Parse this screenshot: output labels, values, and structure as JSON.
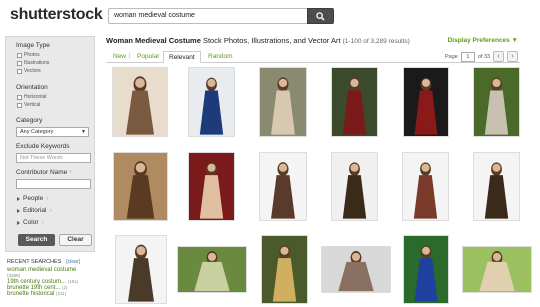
{
  "app": {
    "logo": "shutterstock"
  },
  "search": {
    "value": "woman medieval costume",
    "button_icon": "search-icon"
  },
  "sidebar": {
    "image_type": {
      "label": "Image Type",
      "options": [
        "Photos",
        "Illustrations",
        "Vectors"
      ]
    },
    "orientation": {
      "label": "Orientation",
      "options": [
        "Horizontal",
        "Vertical"
      ]
    },
    "category": {
      "label": "Category",
      "selected": "Any Category"
    },
    "exclude": {
      "label": "Exclude Keywords",
      "placeholder": "Not These Words"
    },
    "contributor": {
      "label": "Contributor Name",
      "help": "?"
    },
    "expanders": [
      {
        "label": "People",
        "help": "?"
      },
      {
        "label": "Editorial",
        "help": "?"
      },
      {
        "label": "Color",
        "help": "?"
      }
    ],
    "search_button": "Search",
    "clear_button": "Clear"
  },
  "recent": {
    "title": "RECENT SEARCHES",
    "clear": "[clear]",
    "items": [
      {
        "label": "woman medieval costume",
        "count": "(3289)"
      },
      {
        "label": "19th century costum...",
        "count": "(161)"
      },
      {
        "label": "brunette 19th cent...",
        "count": "(2)"
      },
      {
        "label": "brunette historical",
        "count": "(211)"
      }
    ]
  },
  "main": {
    "title_bold": "Woman Medieval Costume",
    "title_rest": " Stock Photos, Illustrations, and Vector Art",
    "results": "(1-100 of 3,289 results)",
    "display_prefs": "Display Preferences ▼",
    "tabs": [
      "New",
      "Popular",
      "Relevant",
      "Random"
    ],
    "active_tab": "Relevant",
    "pager": {
      "label": "Page",
      "current": "1",
      "of": "of 33",
      "prev": "‹",
      "next": "›"
    }
  },
  "thumbnails": [
    {
      "name": "thumb-woman-cream-dress",
      "bg": "#e8dccc",
      "fg": "#7a5a40"
    },
    {
      "name": "thumb-woman-blue-gown",
      "bg": "#e8ecef",
      "fg": "#1d3a7a"
    },
    {
      "name": "thumb-woman-forest",
      "bg": "#8a8a70",
      "fg": "#d8c8b0"
    },
    {
      "name": "thumb-woman-red-dark",
      "bg": "#3a4a2a",
      "fg": "#7a1a1a"
    },
    {
      "name": "thumb-woman-red-black",
      "bg": "#1a1a1a",
      "fg": "#8a1a1a"
    },
    {
      "name": "thumb-woman-hood-forest",
      "bg": "#4a6a2a",
      "fg": "#c8c0b0"
    },
    {
      "name": "thumb-woman-fan",
      "bg": "#b08a60",
      "fg": "#5a3a20"
    },
    {
      "name": "thumb-woman-red-curtain",
      "bg": "#7a1a1a",
      "fg": "#e0c0a0"
    },
    {
      "name": "thumb-woman-white-fur",
      "bg": "#f4f4f4",
      "fg": "#5a3a2a"
    },
    {
      "name": "thumb-woman-sword-snow",
      "bg": "#f0f0f0",
      "fg": "#3a2a1a"
    },
    {
      "name": "thumb-woman-snow-red",
      "bg": "#f4f4f4",
      "fg": "#7a3a2a"
    },
    {
      "name": "thumb-woman-brown-fur",
      "bg": "#f4f4f4",
      "fg": "#3a2a1a"
    },
    {
      "name": "thumb-woman-weapon-white",
      "bg": "#f4f4f4",
      "fg": "#4a3a2a"
    },
    {
      "name": "thumb-woman-landscape",
      "bg": "#6a8a40",
      "fg": "#c8d0a0"
    },
    {
      "name": "thumb-woman-crowned",
      "bg": "#4a5a2a",
      "fg": "#d0b060"
    },
    {
      "name": "thumb-woman-portrait-gray",
      "bg": "#d8d8d8",
      "fg": "#8a7060"
    },
    {
      "name": "thumb-woman-blue-dress",
      "bg": "#2a6a2a",
      "fg": "#2040a0"
    },
    {
      "name": "thumb-woman-grass-sunny",
      "bg": "#9ac060",
      "fg": "#e0d0b0"
    }
  ]
}
